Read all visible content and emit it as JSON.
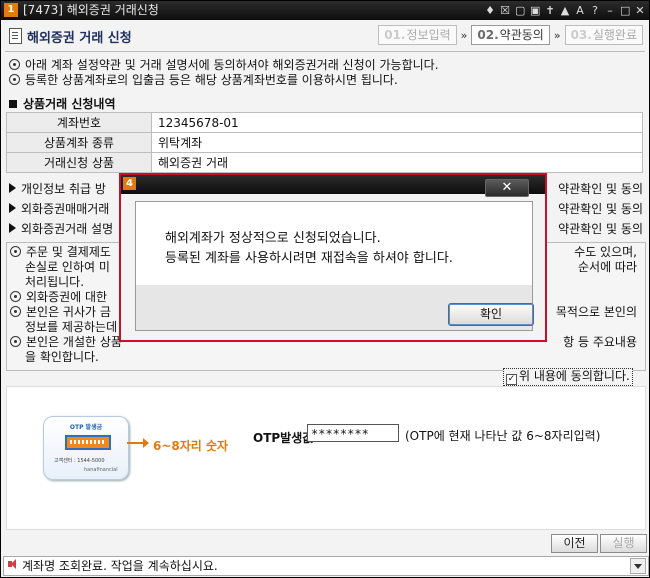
{
  "window": {
    "number": "1",
    "title": "[7473] 해외증권 거래신청",
    "icons": [
      "pin-icon",
      "mail-icon",
      "grid-icon",
      "window-icon",
      "up-icon",
      "lock-icon",
      "a-icon",
      "help-icon",
      "minimize-icon",
      "maximize-icon",
      "close-icon"
    ],
    "icon_glyphs": [
      "♦",
      "☒",
      "▢",
      "▣",
      "✝",
      "▲",
      "A",
      "?",
      "–",
      "□",
      "✕"
    ]
  },
  "header": {
    "title": "해외증권 거래 신청",
    "steps": [
      {
        "num": "01.",
        "label": "정보입력",
        "active": false
      },
      {
        "num": "02.",
        "label": "약관동의",
        "active": true
      },
      {
        "num": "03.",
        "label": "실행완료",
        "active": false
      }
    ],
    "step_arrow": "»"
  },
  "notes": [
    "아래 계좌 설정약관 및 거래 설명서에 동의하셔야 해외증권거래 신청이 가능합니다.",
    "등록한 상품계좌로의 입출금 등은 해당 상품계좌번호를 이용하시면 됩니다."
  ],
  "section_title": "상품거래 신청내역",
  "info_table": [
    {
      "label": "계좌번호",
      "value": "12345678-01"
    },
    {
      "label": "상품계좌 종류",
      "value": "위탁계좌"
    },
    {
      "label": "거래신청 상품",
      "value": "해외증권 거래"
    }
  ],
  "agreement_rows": [
    {
      "left": "개인정보 취급 방",
      "right": "약관확인 및 동의"
    },
    {
      "left": "외화증권매매거래",
      "right": "약관확인 및 동의"
    },
    {
      "left": "외화증권거래 설명",
      "right": "약관확인 및 동의"
    }
  ],
  "agreement_box": [
    {
      "bullet": true,
      "left": "주문 및 결제제도",
      "right": "수도 있으며,"
    },
    {
      "bullet": false,
      "left": "손실로 인하여 미",
      "right": "순서에 따라"
    },
    {
      "bullet": false,
      "left": "처리됩니다.",
      "right": ""
    },
    {
      "bullet": true,
      "left": "외화증권에 대한 ",
      "right": ""
    },
    {
      "bullet": true,
      "left": "본인은 귀사가 금",
      "right": "목적으로 본인의"
    },
    {
      "bullet": false,
      "left": "정보를 제공하는데",
      "right": ""
    },
    {
      "bullet": true,
      "left": "본인은 개설한 상품",
      "right": "항 등 주요내용"
    },
    {
      "bullet": false,
      "left": "을 확인합니다.",
      "right": ""
    }
  ],
  "agree_checkbox": {
    "checked": true,
    "mark": "✓",
    "label": "위 내용에 동의합니다."
  },
  "otp": {
    "card_title": "OTP 발생금",
    "card_phone": "고객센터 : 1544-5000",
    "card_brand": "hanafinancial",
    "digits_label": "6~8자리 숫자",
    "field_label": "OTP발생값",
    "value": "********",
    "hint": "(OTP에 현재 나타난 값 6~8자리입력)"
  },
  "buttons": {
    "prev": "이전",
    "run": "실행"
  },
  "status": {
    "message": "계좌명 조회완료. 작업을 계속하십시요."
  },
  "modal": {
    "number": "4",
    "close_glyph": "✕",
    "line1": "해외계좌가 정상적으로 신청되었습니다.",
    "line2": "등록된 계좌를 사용하시려면 재접속을 하셔야 합니다.",
    "ok": "확인"
  }
}
